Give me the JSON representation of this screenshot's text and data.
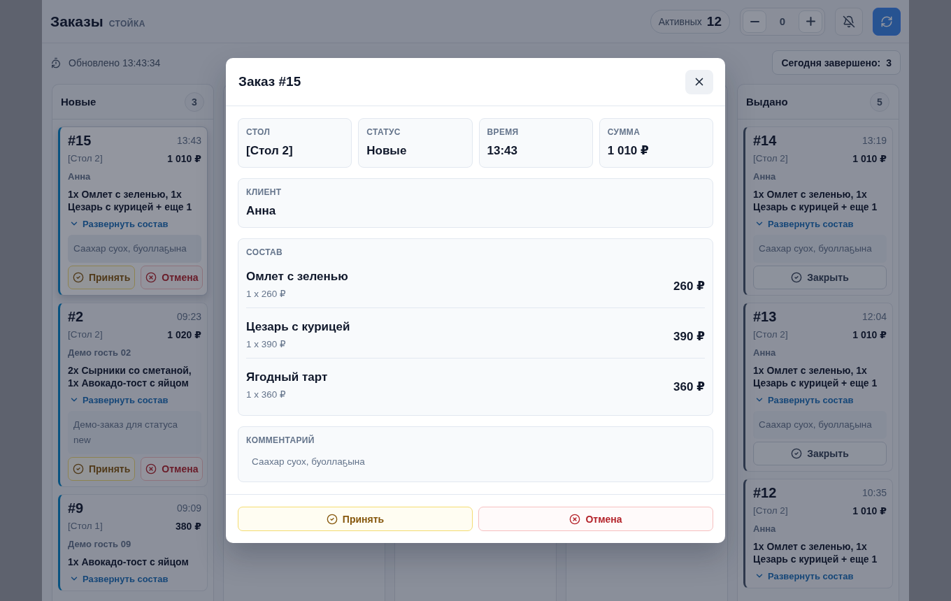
{
  "topbar": {
    "title": "Заказы",
    "subtitle": "СТОЙКА",
    "active_label": "Активных",
    "active_count": "12",
    "stepper_value": "0"
  },
  "infobar": {
    "updated": "Обновлено 13:43:34",
    "completed_label": "Сегодня завершено:",
    "completed_count": "3"
  },
  "columns": [
    {
      "kind": "new",
      "title": "Новые",
      "count": "3",
      "cards": [
        {
          "number": "#15",
          "time": "13:43",
          "table": "[Стол 2]",
          "total": "1 010 ₽",
          "guest": "Анна",
          "items": "1x Омлет с зеленью, 1x Цезарь с курицей + еще 1",
          "expand": "Развернуть состав",
          "comment": "Саахар суох, буоллаҕына",
          "selected": true,
          "actions": [
            {
              "kind": "accept",
              "label": "Принять"
            },
            {
              "kind": "cancel",
              "label": "Отмена"
            }
          ]
        },
        {
          "number": "#2",
          "time": "09:23",
          "table": "[Стол 2]",
          "total": "1 020 ₽",
          "guest": "Демо гость 02",
          "items": "2x Сырники со сметаной, 1x Авокадо-тост с яйцом",
          "expand": "Развернуть состав",
          "comment": "Демо-заказ для статуса new",
          "selected": false,
          "actions": [
            {
              "kind": "accept",
              "label": "Принять"
            },
            {
              "kind": "cancel",
              "label": "Отмена"
            }
          ]
        },
        {
          "number": "#9",
          "time": "09:09",
          "table": "[Стол 1]",
          "total": "380 ₽",
          "guest": "Демо гость 09",
          "items": "1x Авокадо-тост с яйцом",
          "expand": "Развернуть состав",
          "selected": false
        }
      ]
    },
    {
      "kind": "covered"
    },
    {
      "kind": "covered"
    },
    {
      "kind": "covered"
    },
    {
      "kind": "issued",
      "title": "Выдано",
      "count": "5",
      "cards": [
        {
          "number": "#14",
          "time": "13:19",
          "table": "[Стол 2]",
          "total": "1 010 ₽",
          "guest": "Анна",
          "items": "1x Омлет с зеленью, 1x Цезарь с курицей + еще 1",
          "expand": "Развернуть состав",
          "comment": "Саахар суох, буоллаҕына",
          "selected": false,
          "actions": [
            {
              "kind": "close",
              "label": "Закрыть"
            }
          ]
        },
        {
          "number": "#13",
          "time": "12:04",
          "table": "[Стол 2]",
          "total": "1 010 ₽",
          "guest": "Анна",
          "items": "1x Омлет с зеленью, 1x Цезарь с курицей + еще 1",
          "expand": "Развернуть состав",
          "comment": "Саахар суох, буоллаҕына",
          "selected": false,
          "actions": [
            {
              "kind": "close",
              "label": "Закрыть"
            }
          ]
        },
        {
          "number": "#12",
          "time": "10:35",
          "table": "[Стол 2]",
          "total": "1 010 ₽",
          "guest": "Анна",
          "items": "1x Омлет с зеленью, 1x Цезарь с курицей + еще 1",
          "expand": "Развернуть состав",
          "selected": false
        }
      ]
    }
  ],
  "modal": {
    "title": "Заказ #15",
    "stats": [
      {
        "label": "СТОЛ",
        "value": "[Стол 2]"
      },
      {
        "label": "СТАТУС",
        "value": "Новые"
      },
      {
        "label": "ВРЕМЯ",
        "value": "13:43"
      },
      {
        "label": "СУММА",
        "value": "1 010 ₽"
      }
    ],
    "client": {
      "label": "КЛИЕНТ",
      "value": "Анна"
    },
    "composition": {
      "label": "СОСТАВ",
      "rows": [
        {
          "name": "Омлет с зеленью",
          "detail": "1 x 260 ₽",
          "price": "260 ₽"
        },
        {
          "name": "Цезарь с курицей",
          "detail": "1 x 390 ₽",
          "price": "390 ₽"
        },
        {
          "name": "Ягодный тарт",
          "detail": "1 x 360 ₽",
          "price": "360 ₽"
        }
      ]
    },
    "comment": {
      "label": "КОММЕНТАРИЙ",
      "text": "Саахар суох, буоллаҕына"
    },
    "actions": [
      {
        "kind": "accept",
        "label": "Принять"
      },
      {
        "kind": "cancel",
        "label": "Отмена"
      }
    ]
  }
}
